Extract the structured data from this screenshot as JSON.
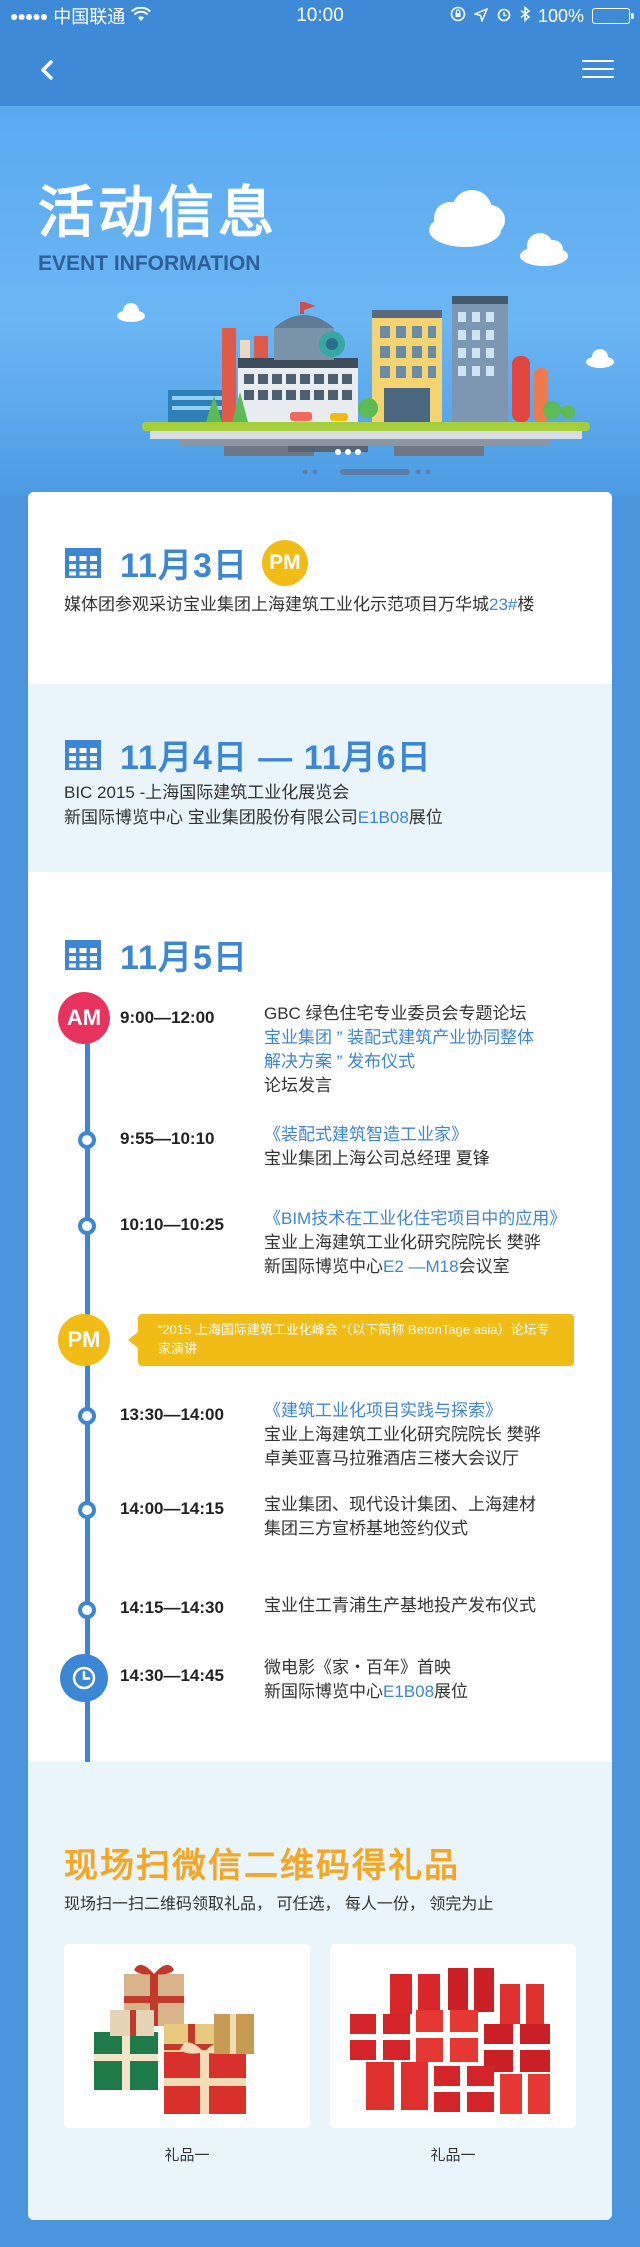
{
  "status_bar": {
    "carrier": "中国联通",
    "time": "10:00",
    "battery": "100%"
  },
  "hero": {
    "title": "活动信息",
    "subtitle": "EVENT INFORMATION"
  },
  "section1": {
    "date": "11月3日",
    "period": "PM",
    "desc_prefix": "媒体团参观采访宝业集团上海建筑工业化示范项目万华城",
    "desc_highlight": "23#",
    "desc_suffix": "楼"
  },
  "section2": {
    "date": "11月4日 — 11月6日",
    "line1": "BIC 2015 -上海国际建筑工业化展览会",
    "line2_prefix": "新国际博览中心    宝业集团股份有限公司",
    "line2_highlight": "E1B08",
    "line2_suffix": "展位"
  },
  "section3": {
    "date": "11月5日",
    "am_label": "AM",
    "pm_label": "PM",
    "callout": "“2015 上海国际建筑工业化峰会 ”（以下简称 BetonTage asia）论坛专家演讲",
    "items": [
      {
        "time": "9:00—12:00",
        "lines": [
          {
            "text": "GBC 绿色住宅专业委员会专题论坛",
            "hl": false
          },
          {
            "text": "宝业集团 ” 装配式建筑产业协同整体",
            "hl": true
          },
          {
            "text": "解决方案 ” 发布仪式",
            "hl": true
          },
          {
            "text": "论坛发言",
            "hl": false
          }
        ]
      },
      {
        "time": "9:55—10:10",
        "lines": [
          {
            "text": "《装配式建筑智造工业家》",
            "hl": true
          },
          {
            "text": "宝业集团上海公司总经理    夏锋",
            "hl": false
          }
        ]
      },
      {
        "time": "10:10—10:25",
        "lines": [
          {
            "text": "《BIM技术在工业化住宅项目中的应用》",
            "hl": true
          },
          {
            "text": "宝业上海建筑工业化研究院院长   樊骅",
            "hl": false
          },
          {
            "text": "新国际博览中心",
            "hl": false,
            "suffix_hl": "E2 —M18",
            "suffix": "会议室"
          }
        ]
      },
      {
        "time": "13:30—14:00",
        "lines": [
          {
            "text": "《建筑工业化项目实践与探索》",
            "hl": true
          },
          {
            "text": "宝业上海建筑工业化研究院院长   樊骅",
            "hl": false
          },
          {
            "text": "卓美亚喜马拉雅酒店三楼大会议厅",
            "hl": false
          }
        ]
      },
      {
        "time": "14:00—14:15",
        "lines": [
          {
            "text": "宝业集团、现代设计集团、上海建材",
            "hl": false
          },
          {
            "text": "集团三方宣桥基地签约仪式",
            "hl": false
          }
        ]
      },
      {
        "time": "14:15—14:30",
        "lines": [
          {
            "text": "宝业住工青浦生产基地投产发布仪式",
            "hl": false
          }
        ]
      },
      {
        "time": "14:30—14:45",
        "lines": [
          {
            "text": "微电影《家・百年》首映",
            "hl": false
          },
          {
            "text": "新国际博览中心",
            "hl": false,
            "suffix_hl": "E1B08",
            "suffix": "展位"
          }
        ]
      }
    ]
  },
  "gifts": {
    "title": "现场扫微信二维码得礼品",
    "desc": "现场扫一扫二维码领取礼品，  可任选，  每人一份，  领完为止",
    "items": [
      {
        "label": "礼品一"
      },
      {
        "label": "礼品一"
      }
    ]
  },
  "colors": {
    "primary": "#3c86d6",
    "am": "#e9335f",
    "pm": "#f2bc17",
    "gift_title": "#f5a623"
  }
}
